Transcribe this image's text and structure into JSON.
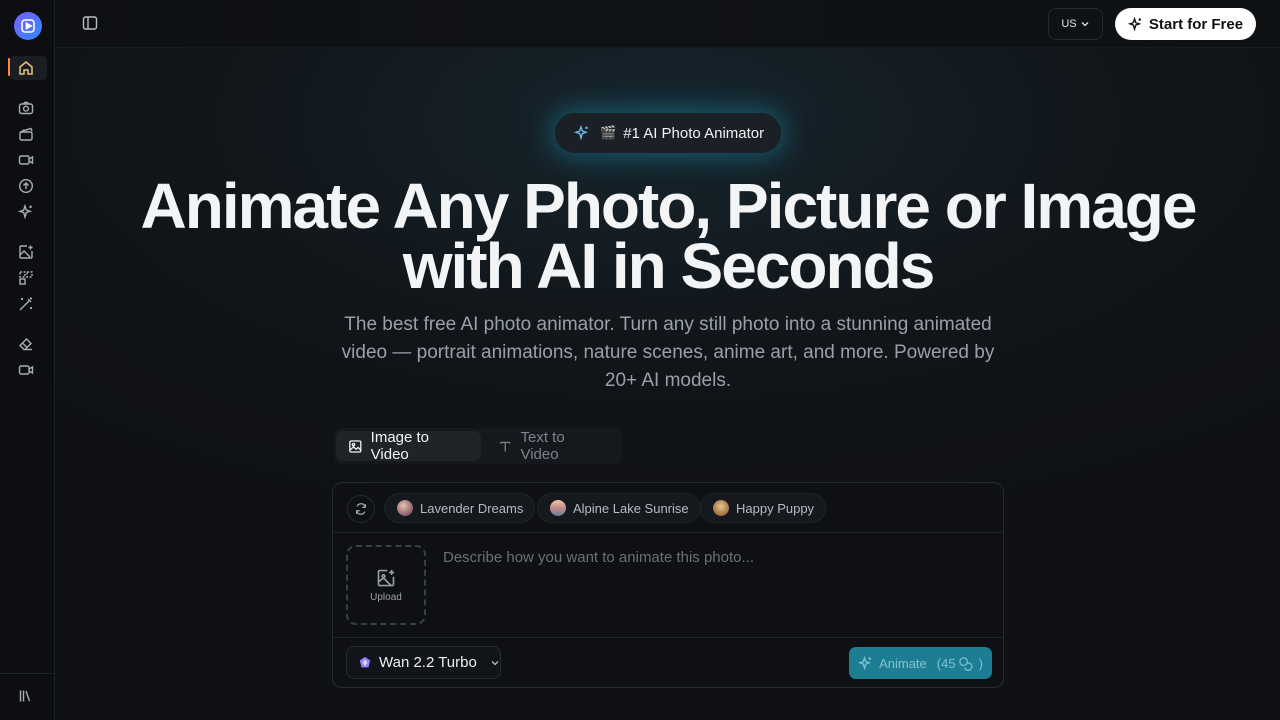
{
  "topbar": {
    "region": "US",
    "start_label": "Start for Free"
  },
  "sidebar": {
    "items": [
      "home-icon",
      "camera-icon",
      "clapperboard-icon",
      "video-icon",
      "upload-circle-icon",
      "sparkles-icon",
      "image-plus-icon",
      "layout-dashed-icon",
      "magic-wand-icon",
      "eraser-icon",
      "video-camera-icon"
    ],
    "footer_icon": "library-icon",
    "active_accent": "#ff8a3d"
  },
  "hero": {
    "badge": "#1 AI Photo Animator",
    "title": "Animate Any Photo, Picture or Image with AI in Seconds",
    "subtitle": "The best free AI photo animator. Turn any still photo into a stunning animated video — portrait animations, nature scenes, anime art, and more. Powered by 20+ AI models."
  },
  "tabs": [
    {
      "label": "Image to Video",
      "active": true
    },
    {
      "label": "Text to Video",
      "active": false
    }
  ],
  "presets": [
    {
      "label": "Lavender Dreams"
    },
    {
      "label": "Alpine Lake Sunrise"
    },
    {
      "label": "Happy Puppy"
    }
  ],
  "upload": {
    "label": "Upload"
  },
  "prompt": {
    "placeholder": "Describe how you want to animate this photo...",
    "value": ""
  },
  "model": {
    "label": "Wan 2.2 Turbo"
  },
  "animate": {
    "label": "Animate",
    "cost": "(45",
    "cost_close": ")"
  },
  "colors": {
    "accent": "#1d7e93",
    "glow": "#1ea0be"
  }
}
